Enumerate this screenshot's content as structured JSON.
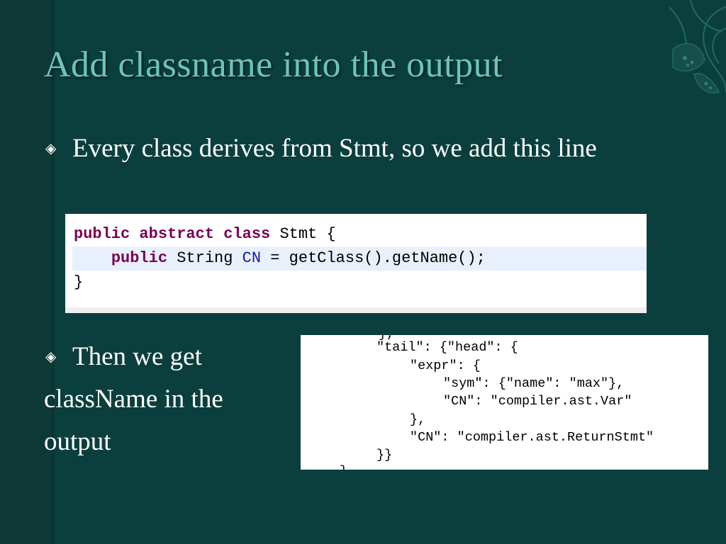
{
  "slide": {
    "title": "Add classname into the output",
    "bullet1": "Every class derives from Stmt, so we add this line",
    "bullet2_line1": "Then we get",
    "bullet2_line2": "className in the",
    "bullet2_line3": "output"
  },
  "code_snippet": {
    "line1_kw": "public abstract class ",
    "line1_rest": "Stmt {",
    "line2_kw": "public ",
    "line2_type": "String ",
    "line2_field": "CN",
    "line2_rest": " = getClass().getName();",
    "line3": "}"
  },
  "json_output": {
    "line0": "},",
    "line1": "\"tail\": {\"head\": {",
    "line2": "\"expr\": {",
    "line3": "\"sym\": {\"name\": \"max\"},",
    "line4": "\"CN\": \"compiler.ast.Var\"",
    "line5": "},",
    "line6": "\"CN\": \"compiler.ast.ReturnStmt\"",
    "line7": "}}",
    "line8": "},"
  },
  "colors": {
    "background": "#0b3f3d",
    "title": "#6fc3b6",
    "keyword": "#7a0055",
    "field": "#1a1aa6"
  }
}
